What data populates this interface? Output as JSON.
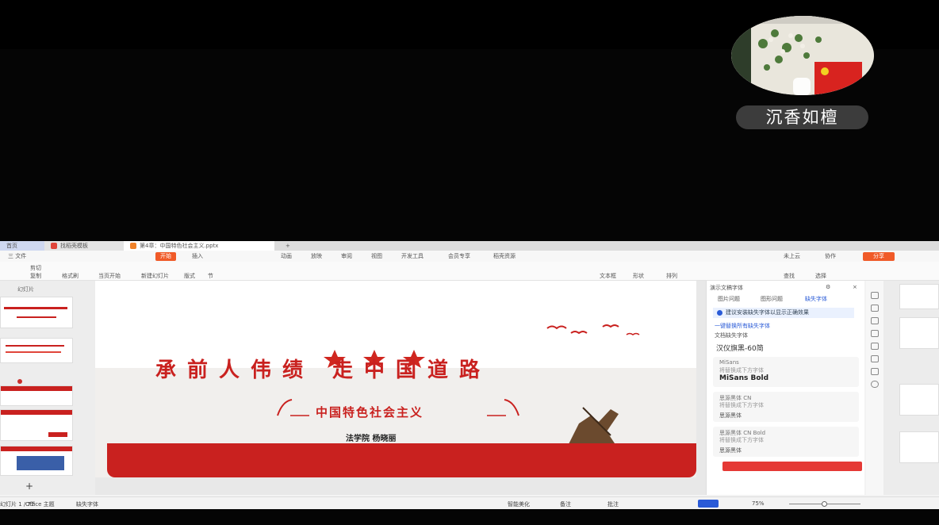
{
  "call": {
    "participant_name": "沉香如檀"
  },
  "tabs": {
    "home": "首页",
    "template": "找稻壳模板",
    "doc": "第4章：中国特色社会主义.pptx"
  },
  "menu": {
    "file": "三 文件",
    "start": "开始",
    "insert": "插入",
    "animation": "动画",
    "show": "放映",
    "review": "审阅",
    "view": "视图",
    "dev": "开发工具",
    "member": "会员专享",
    "effect": "稻壳资源",
    "unsync": "未上云",
    "collab": "协作",
    "share": "分享"
  },
  "ribbon": {
    "cut": "剪切",
    "copy": "复制",
    "format_brush": "格式刷",
    "from_current": "当页开始",
    "new_slide": "新建幻灯片",
    "layout": "版式",
    "section": "节",
    "textbox": "文本框",
    "shape": "形状",
    "arrange": "排列",
    "find": "查找",
    "select": "选择"
  },
  "thumbs": {
    "label": "幻灯片",
    "add": "+"
  },
  "slide": {
    "title": "承前人伟绩 走中国道路",
    "subtitle": "中国特色社会主义",
    "author": "法学院  杨晓丽"
  },
  "pane": {
    "header": "演示文稿字体",
    "tab1": "图片问题",
    "tab2": "图形问题",
    "tab3": "缺失字体",
    "notice": "建议安装缺失字体以显示正确效果",
    "link": "一键替换所有缺失字体",
    "section": "文档缺失字体",
    "count": "汉仪旗黑-60简",
    "fonts": [
      {
        "name": "MiSans",
        "desc": "将替换成下方字体",
        "replacement": "MiSans Bold"
      },
      {
        "name": "思源黑体 CN",
        "desc": "将替换成下方字体",
        "replacement": "思源黑体"
      },
      {
        "name": "思源黑体 CN Bold",
        "desc": "将替换成下方字体",
        "replacement": "思源黑体"
      }
    ]
  },
  "status": {
    "slide_info": "幻灯片 1 / 72",
    "theme": "Office 主题",
    "missing_font": "缺失字体",
    "smart_beautify": "智能美化",
    "notes": "备注",
    "comment": "批注",
    "zoom": "75%"
  },
  "colors": {
    "accent": "#f05a28",
    "slide_red": "#c9211f",
    "link_blue": "#2a5bd7"
  }
}
